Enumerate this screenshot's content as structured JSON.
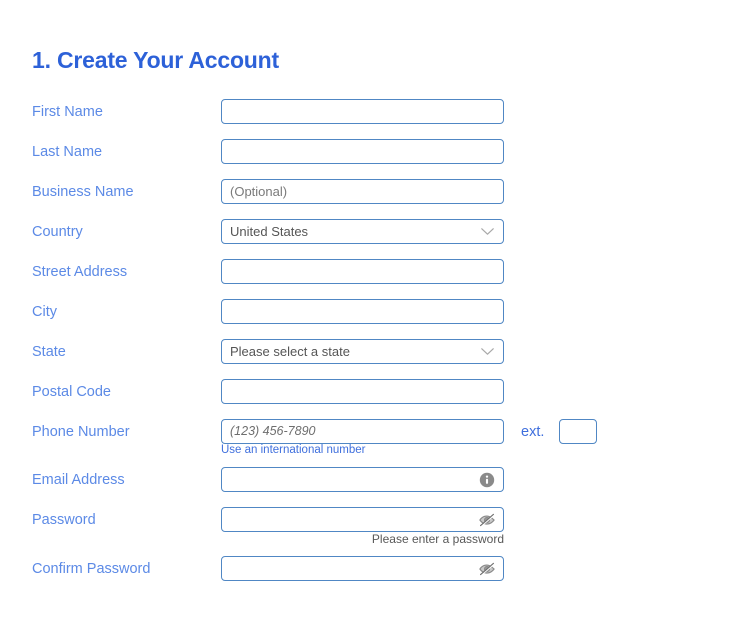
{
  "page": {
    "title": "1. Create Your Account"
  },
  "colors": {
    "title_blue": "#2d61d8",
    "label_blue": "#5c8ae6",
    "link_blue": "#3f6fdd",
    "input_border": "#5087c4",
    "placeholder_gray": "#7a7a7a",
    "helper_gray": "#585858",
    "icon_gray": "#8a8a8a",
    "background": "#ffffff"
  },
  "form": {
    "fields": [
      {
        "label": "First Name",
        "type": "text",
        "value": "",
        "placeholder": "",
        "name": "first-name"
      },
      {
        "label": "Last Name",
        "type": "text",
        "value": "",
        "placeholder": "",
        "name": "last-name"
      },
      {
        "label": "Business Name",
        "type": "text",
        "value": "",
        "placeholder": "(Optional)",
        "name": "business-name"
      },
      {
        "label": "Country",
        "type": "select",
        "value": "United States",
        "placeholder": "",
        "name": "country"
      },
      {
        "label": "Street Address",
        "type": "text",
        "value": "",
        "placeholder": "",
        "name": "street-address"
      },
      {
        "label": "City",
        "type": "text",
        "value": "",
        "placeholder": "",
        "name": "city"
      },
      {
        "label": "State",
        "type": "select",
        "value": "Please select a state",
        "placeholder": "",
        "name": "state"
      },
      {
        "label": "Postal Code",
        "type": "text",
        "value": "",
        "placeholder": "",
        "name": "postal-code"
      },
      {
        "label": "Phone Number",
        "type": "phone",
        "value": "",
        "placeholder": "(123) 456-7890",
        "name": "phone-number",
        "ext_label": "ext.",
        "ext_value": "",
        "helper_link": "Use an international number"
      },
      {
        "label": "Email Address",
        "type": "text",
        "value": "",
        "placeholder": "",
        "name": "email-address",
        "trailing_icon": "info-icon"
      },
      {
        "label": "Password",
        "type": "password",
        "value": "",
        "placeholder": "",
        "name": "password",
        "trailing_icon": "eye-slash-icon",
        "helper_note": "Please enter a password"
      },
      {
        "label": "Confirm Password",
        "type": "password",
        "value": "",
        "placeholder": "",
        "name": "confirm-password",
        "trailing_icon": "eye-slash-icon"
      }
    ]
  }
}
